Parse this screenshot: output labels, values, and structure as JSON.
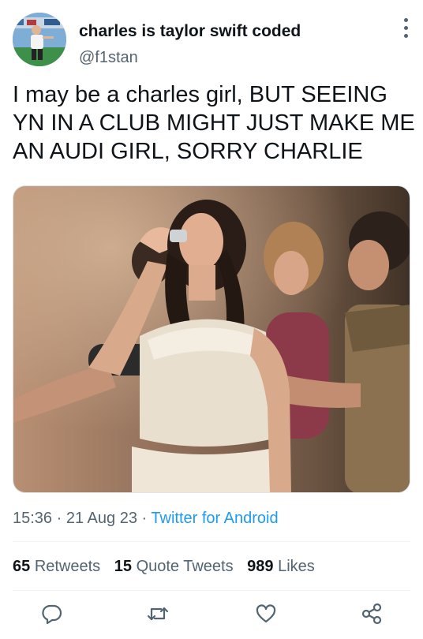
{
  "user": {
    "display_name": "charles is taylor swift coded",
    "handle": "@f1stan",
    "avatar_icon": "profile-photo"
  },
  "tweet": {
    "text": "I may be a charles girl, BUT SEEING YN IN A CLUB MIGHT JUST MAKE ME AN AUDI GIRL, SORRY CHARLIE",
    "media_description": "photo"
  },
  "meta": {
    "time": "15:36",
    "separator": "·",
    "date": "21 Aug 23",
    "source": "Twitter for Android"
  },
  "stats": {
    "retweets_count": "65",
    "retweets_label": "Retweets",
    "quotes_count": "15",
    "quotes_label": "Quote Tweets",
    "likes_count": "989",
    "likes_label": "Likes"
  },
  "actions": {
    "icons": [
      "reply-icon",
      "retweet-icon",
      "like-icon",
      "share-icon"
    ]
  },
  "colors": {
    "accent": "#1d9bf0",
    "secondary_text": "#536471",
    "primary_text": "#0f1419"
  }
}
